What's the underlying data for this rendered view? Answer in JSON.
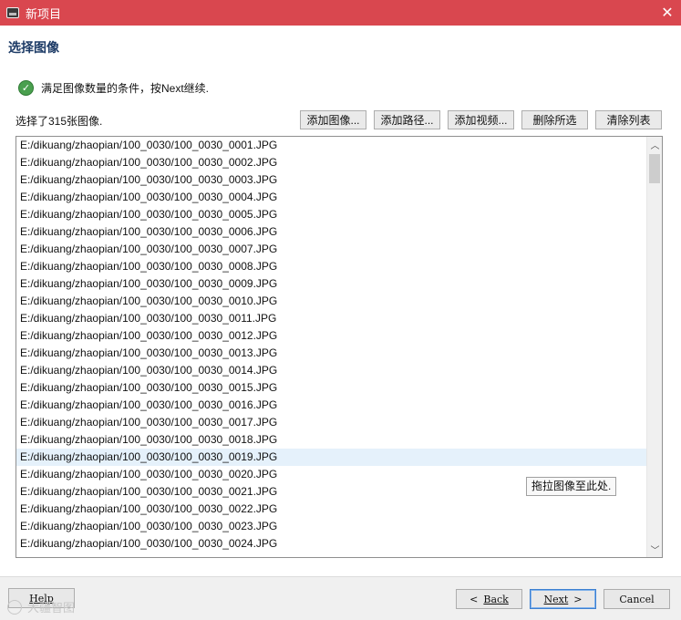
{
  "window": {
    "title": "新项目",
    "close_glyph": "✕"
  },
  "page_title": "选择图像",
  "status": {
    "icon": "check-circle-icon",
    "message": "满足图像数量的条件，按Next继续."
  },
  "count_label": "选择了315张图像.",
  "toolbar": {
    "add_images": "添加图像...",
    "add_path": "添加路径...",
    "add_video": "添加视频...",
    "delete_selected": "删除所选",
    "clear_list": "清除列表"
  },
  "files": [
    "E:/dikuang/zhaopian/100_0030/100_0030_0001.JPG",
    "E:/dikuang/zhaopian/100_0030/100_0030_0002.JPG",
    "E:/dikuang/zhaopian/100_0030/100_0030_0003.JPG",
    "E:/dikuang/zhaopian/100_0030/100_0030_0004.JPG",
    "E:/dikuang/zhaopian/100_0030/100_0030_0005.JPG",
    "E:/dikuang/zhaopian/100_0030/100_0030_0006.JPG",
    "E:/dikuang/zhaopian/100_0030/100_0030_0007.JPG",
    "E:/dikuang/zhaopian/100_0030/100_0030_0008.JPG",
    "E:/dikuang/zhaopian/100_0030/100_0030_0009.JPG",
    "E:/dikuang/zhaopian/100_0030/100_0030_0010.JPG",
    "E:/dikuang/zhaopian/100_0030/100_0030_0011.JPG",
    "E:/dikuang/zhaopian/100_0030/100_0030_0012.JPG",
    "E:/dikuang/zhaopian/100_0030/100_0030_0013.JPG",
    "E:/dikuang/zhaopian/100_0030/100_0030_0014.JPG",
    "E:/dikuang/zhaopian/100_0030/100_0030_0015.JPG",
    "E:/dikuang/zhaopian/100_0030/100_0030_0016.JPG",
    "E:/dikuang/zhaopian/100_0030/100_0030_0017.JPG",
    "E:/dikuang/zhaopian/100_0030/100_0030_0018.JPG",
    "E:/dikuang/zhaopian/100_0030/100_0030_0019.JPG",
    "E:/dikuang/zhaopian/100_0030/100_0030_0020.JPG",
    "E:/dikuang/zhaopian/100_0030/100_0030_0021.JPG",
    "E:/dikuang/zhaopian/100_0030/100_0030_0022.JPG",
    "E:/dikuang/zhaopian/100_0030/100_0030_0023.JPG",
    "E:/dikuang/zhaopian/100_0030/100_0030_0024.JPG"
  ],
  "hovered_file": "E:/dikuang/zhaopian/100_0030/100_0030_0019.JPG",
  "drop_hint": "拖拉图像至此处.",
  "scrollbar": {
    "up_glyph": "︿",
    "down_glyph": "﹀"
  },
  "footer": {
    "help": "Help",
    "back_arrow": "<",
    "back": "Back",
    "next": "Next",
    "next_arrow": ">",
    "cancel": "Cancel"
  },
  "watermark": "大疆智图",
  "colors": {
    "titlebar": "#d9474f",
    "heading": "#1d3b66",
    "success": "#4aa04f",
    "hover_row": "#e5f1fb"
  }
}
